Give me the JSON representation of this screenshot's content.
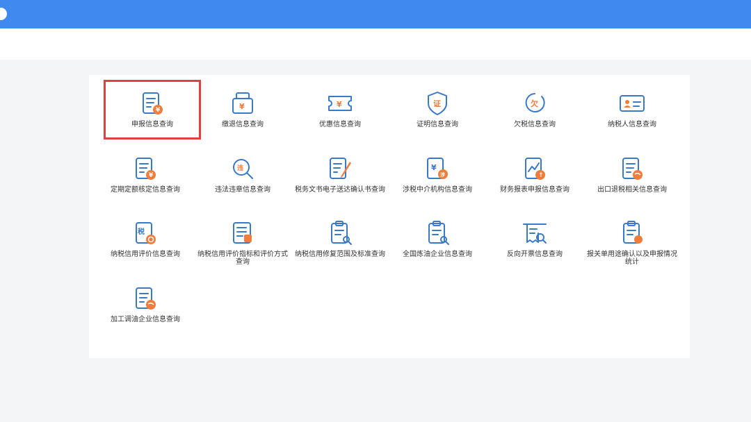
{
  "items": [
    {
      "label": "申报信息查询",
      "icon": "declaration-doc-icon"
    },
    {
      "label": "缴退信息查询",
      "icon": "payment-bag-icon"
    },
    {
      "label": "优惠信息查询",
      "icon": "coupon-ticket-icon"
    },
    {
      "label": "证明信息查询",
      "icon": "certificate-shield-icon"
    },
    {
      "label": "欠税信息查询",
      "icon": "arrears-clock-icon"
    },
    {
      "label": "纳税人信息查询",
      "icon": "taxpayer-card-icon"
    },
    {
      "label": "定期定额核定信息查询",
      "icon": "fixed-quota-doc-icon"
    },
    {
      "label": "违法违章信息查询",
      "icon": "violation-search-icon"
    },
    {
      "label": "税务文书电子送达确认书查询",
      "icon": "document-pen-icon"
    },
    {
      "label": "涉税中介机构信息查询",
      "icon": "agency-doc-icon"
    },
    {
      "label": "财务报表申报信息查询",
      "icon": "report-chart-icon"
    },
    {
      "label": "出口退税相关信息查询",
      "icon": "export-globe-doc-icon"
    },
    {
      "label": "纳税信用评价信息查询",
      "icon": "credit-rating-icon"
    },
    {
      "label": "纳税信用评价指标和评价方式查询",
      "icon": "credit-index-icon"
    },
    {
      "label": "纳税信用修复范围及标准查询",
      "icon": "credit-repair-clipboard-icon"
    },
    {
      "label": "全国炼油企业信息查询",
      "icon": "refinery-clipboard-icon"
    },
    {
      "label": "反向开票信息查询",
      "icon": "reverse-invoice-icon"
    },
    {
      "label": "报关单用途确认以及申报情况统计",
      "icon": "customs-clipboard-icon"
    },
    {
      "label": "加工调油企业信息查询",
      "icon": "oil-blending-doc-icon"
    }
  ],
  "selected_index": 0,
  "colors": {
    "topbar": "#4089ee",
    "icon_blue": "#3a78c8",
    "icon_orange": "#f07d3c",
    "highlight": "#e0413f"
  }
}
